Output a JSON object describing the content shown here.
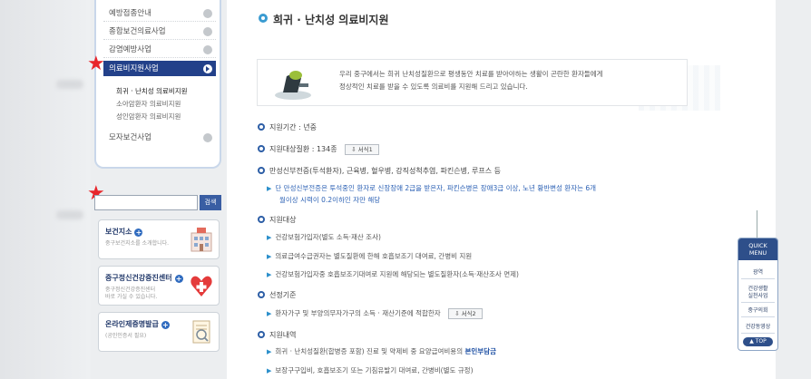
{
  "menu": {
    "items": [
      {
        "label": "예방접종안내"
      },
      {
        "label": "종합보건의료사업"
      },
      {
        "label": "감염예방사업"
      },
      {
        "label": "의료비지원사업"
      },
      {
        "label": "모자보건사업"
      }
    ],
    "subitems": [
      {
        "label": "희귀 · 난치성 의료비지원"
      },
      {
        "label": "소아암환자 의료비지원"
      },
      {
        "label": "성인암환자 의료비지원"
      }
    ]
  },
  "search": {
    "button": "검색",
    "value": ""
  },
  "cards": [
    {
      "title": "보건지소",
      "desc": "중구보건지소를 소개합니다."
    },
    {
      "title": "중구정신건강증진센터",
      "desc1": "중구정신건강증진센터",
      "desc2": "바로 가실 수 있습니다."
    },
    {
      "title": "온라인제증명발급",
      "desc": "(공인인증서 필요)"
    }
  ],
  "content": {
    "title": "희귀 · 난치성 의료비지원",
    "intro1": "우리 중구에서는 희귀 난치성질환으로 평생동안 치료를 받아야하는 생활이 곤란한 환자들에게",
    "intro2": "정상적인 치료를 받을 수 있도록 의료비를 지원해 드리고 있습니다.",
    "period": "지원기간 : 년중",
    "diseases": "지원대상질환 : 134종",
    "form1": "서식1",
    "chronic": "만성신부전증(투석환자), 근육병, 혈우병, 강직성척추염, 파킨슨병, 루프스 등",
    "chronic_note1": "단 만성신부전증은 투석중인 환자로 신장장애 2급을 받은자, 파킨슨병은 장애3급 이상, 노년 황반변성 환자는 6개",
    "chronic_note2": "월이상 시력이 0.2이하인 자만 해당",
    "target": "지원대상",
    "target1": "건강보험가입자(별도 소득·재산 조사)",
    "target2": "의료급여수급권자는 별도질환에 한해 호흡보조기 대여료, 간병비 지원",
    "target3": "건강보험가입자중 호흡보조기대여로 지원에 해당되는 별도질환자(소득·재산조사 면제)",
    "criteria": "선정기준",
    "criteria1": "환자가구 및 부양의무자가구의 소득 · 재산기준에 적합한자",
    "form2": "서식2",
    "details": "지원내역",
    "details1_pre": "희귀 · 난치성질환(합병증 포함) 진료 및 약제비 중 요양급여비용의 ",
    "details1_bold": "본인부담금",
    "details2": "보장구구입비, 호흡보조기 또는 기침유발기 대여료, 간병비(별도 규정)"
  },
  "quick": {
    "header": "QUICK\nMENU",
    "items": [
      "광역",
      "건강생활\n실천사업",
      "중구의회",
      "건강동영상"
    ],
    "top": "TOP"
  },
  "colors": {
    "accent": "#23418a",
    "star": "#e8262b",
    "link": "#2d62b5"
  }
}
